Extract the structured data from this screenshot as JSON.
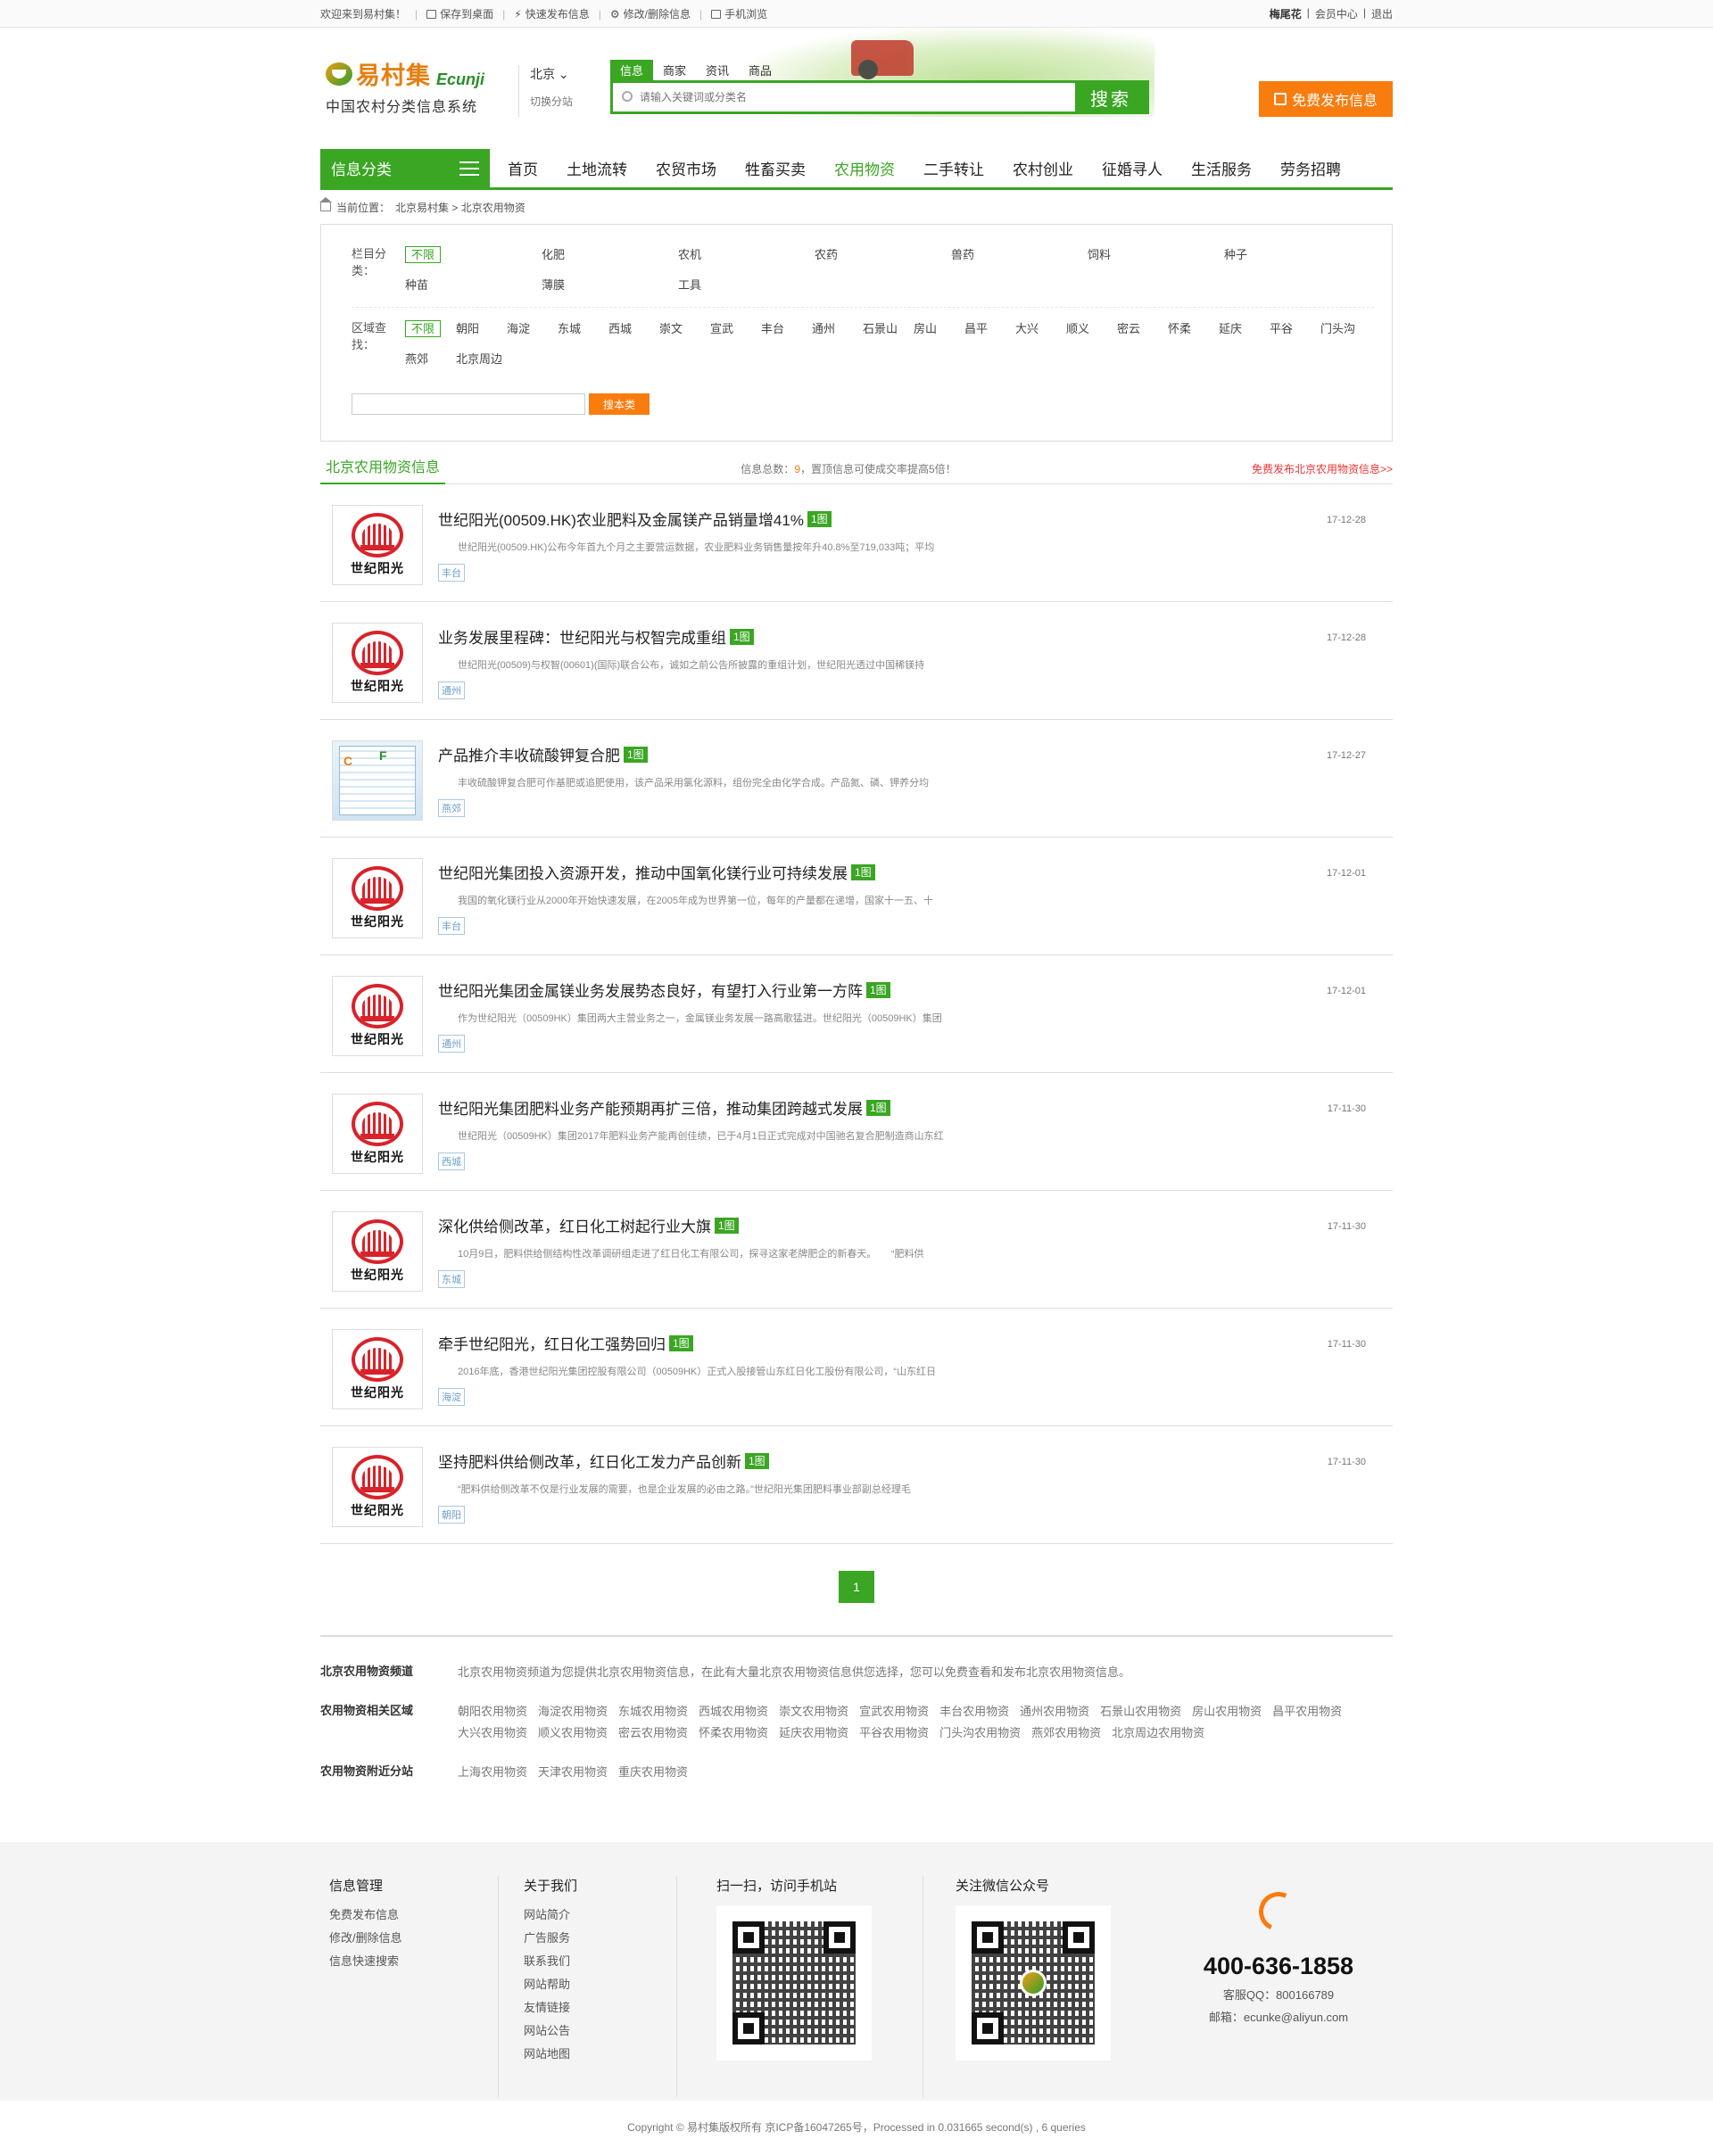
{
  "topbar": {
    "welcome": "欢迎来到易村集！",
    "links": [
      "保存到桌面",
      "快速发布信息",
      "修改/删除信息",
      "手机浏览"
    ],
    "user": "梅尾花",
    "member": "会员中心",
    "logout": "退出"
  },
  "header": {
    "logo_cn": "易村集",
    "logo_en": "Ecunji",
    "slogan": "中国农村分类信息系统",
    "city": "北京",
    "switch_city": "切换分站",
    "search_tabs": [
      "信息",
      "商家",
      "资讯",
      "商品"
    ],
    "search_placeholder": "请输入关键词或分类名",
    "search_button": "搜索",
    "publish_button": "免费发布信息"
  },
  "nav": {
    "category_label": "信息分类",
    "items": [
      "首页",
      "土地流转",
      "农贸市场",
      "牲畜买卖",
      "农用物资",
      "二手转让",
      "农村创业",
      "征婚寻人",
      "生活服务",
      "劳务招聘"
    ],
    "active_index": 4
  },
  "breadcrumb": {
    "prefix": "当前位置：",
    "path": "北京易村集 > 北京农用物资"
  },
  "filter": {
    "category_label": "栏目分类：",
    "categories": [
      "不限",
      "化肥",
      "农机",
      "农药",
      "兽药",
      "饲料",
      "种子",
      "种苗",
      "薄膜",
      "工具"
    ],
    "area_label": "区域查找：",
    "areas": [
      "不限",
      "朝阳",
      "海淀",
      "东城",
      "西城",
      "崇文",
      "宣武",
      "丰台",
      "通州",
      "石景山",
      "房山",
      "昌平",
      "大兴",
      "顺义",
      "密云",
      "怀柔",
      "延庆",
      "平谷",
      "门头沟",
      "燕郊",
      "北京周边"
    ],
    "search_button": "搜本类"
  },
  "list": {
    "title": "北京农用物资信息",
    "count_prefix": "信息总数：",
    "count": "9",
    "count_suffix": "，置顶信息可使成交率提高5倍！",
    "publish_link": "免费发布北京农用物资信息>>",
    "items": [
      {
        "title": "世纪阳光(00509.HK)农业肥料及金属镁产品销量增41%",
        "badge": "1图",
        "desc": "世纪阳光(00509.HK)公布今年首九个月之主要营运数据，农业肥料业务销售量按年升40.8%至719,033吨；平均",
        "tag": "丰台",
        "date": "17-12-28",
        "thumb": "sun"
      },
      {
        "title": "业务发展里程碑：世纪阳光与权智完成重组",
        "badge": "1图",
        "desc": "世纪阳光(00509)与权智(00601)(国际)联合公布，诚如之前公告所披露的重组计划，世纪阳光透过中国稀镁持",
        "tag": "通州",
        "date": "17-12-28",
        "thumb": "sun"
      },
      {
        "title": "产品推介丰收硫酸钾复合肥",
        "badge": "1图",
        "desc": "丰收硫酸钾复合肥可作基肥或追肥使用，该产品采用氯化源料，组份完全由化学合成。产品氮、磷、钾养分均",
        "tag": "燕郊",
        "date": "17-12-27",
        "thumb": "poster"
      },
      {
        "title": "世纪阳光集团投入资源开发，推动中国氧化镁行业可持续发展",
        "badge": "1图",
        "desc": "我国的氧化镁行业从2000年开始快速发展，在2005年成为世界第一位，每年的产量都在递增，国家十一五、十",
        "tag": "丰台",
        "date": "17-12-01",
        "thumb": "sun"
      },
      {
        "title": "世纪阳光集团金属镁业务发展势态良好，有望打入行业第一方阵",
        "badge": "1图",
        "desc": "作为世纪阳光（00509HK）集团两大主营业务之一，金属镁业务发展一路高歌猛进。世纪阳光（00509HK）集团",
        "tag": "通州",
        "date": "17-12-01",
        "thumb": "sun"
      },
      {
        "title": "世纪阳光集团肥料业务产能预期再扩三倍，推动集团跨越式发展",
        "badge": "1图",
        "desc": "世纪阳光（00509HK）集团2017年肥料业务产能再创佳绩，已于4月1日正式完成对中国驰名复合肥制造商山东红",
        "tag": "西城",
        "date": "17-11-30",
        "thumb": "sun"
      },
      {
        "title": "深化供给侧改革，红日化工树起行业大旗",
        "badge": "1图",
        "desc": "10月9日，肥料供给侧结构性改革调研组走进了红日化工有限公司，探寻这家老牌肥企的新春天。　　“肥料供",
        "tag": "东城",
        "date": "17-11-30",
        "thumb": "sun"
      },
      {
        "title": "牵手世纪阳光，红日化工强势回归",
        "badge": "1图",
        "desc": "2016年底，香港世纪阳光集团控股有限公司（00509HK）正式入股接管山东红日化工股份有限公司，“山东红日",
        "tag": "海淀",
        "date": "17-11-30",
        "thumb": "sun"
      },
      {
        "title": "坚持肥料供给侧改革，红日化工发力产品创新",
        "badge": "1图",
        "desc": "“肥料供给侧改革不仅是行业发展的需要，也是企业发展的必由之路。”世纪阳光集团肥料事业部副总经理毛",
        "tag": "朝阳",
        "date": "17-11-30",
        "thumb": "sun"
      }
    ],
    "thumb_text": "世纪阳光"
  },
  "pager": {
    "current": "1"
  },
  "seo": {
    "channel_label": "北京农用物资频道",
    "channel_text": "北京农用物资频道为您提供北京农用物资信息，在此有大量北京农用物资信息供您选择，您可以免费查看和发布北京农用物资信息。",
    "area_label": "农用物资相关区域",
    "area_links": [
      "朝阳农用物资",
      "海淀农用物资",
      "东城农用物资",
      "西城农用物资",
      "崇文农用物资",
      "宣武农用物资",
      "丰台农用物资",
      "通州农用物资",
      "石景山农用物资",
      "房山农用物资",
      "昌平农用物资",
      "大兴农用物资",
      "顺义农用物资",
      "密云农用物资",
      "怀柔农用物资",
      "延庆农用物资",
      "平谷农用物资",
      "门头沟农用物资",
      "燕郊农用物资",
      "北京周边农用物资"
    ],
    "near_label": "农用物资附近分站",
    "near_links": [
      "上海农用物资",
      "天津农用物资",
      "重庆农用物资"
    ]
  },
  "footer": {
    "col1_title": "信息管理",
    "col1_links": [
      "免费发布信息",
      "修改/删除信息",
      "信息快速搜索"
    ],
    "col2_title": "关于我们",
    "col2_links": [
      "网站简介",
      "广告服务",
      "联系我们",
      "网站帮助",
      "友情链接",
      "网站公告",
      "网站地图"
    ],
    "col3_title": "扫一扫，访问手机站",
    "col4_title": "关注微信公众号",
    "phone": "400-636-1858",
    "qq": "客服QQ：800166789",
    "email": "邮箱：ecunke@aliyun.com"
  },
  "copyright": "Copyright © 易村集版权所有 京ICP备16047265号，Processed in 0.031665 second(s) , 6 queries"
}
